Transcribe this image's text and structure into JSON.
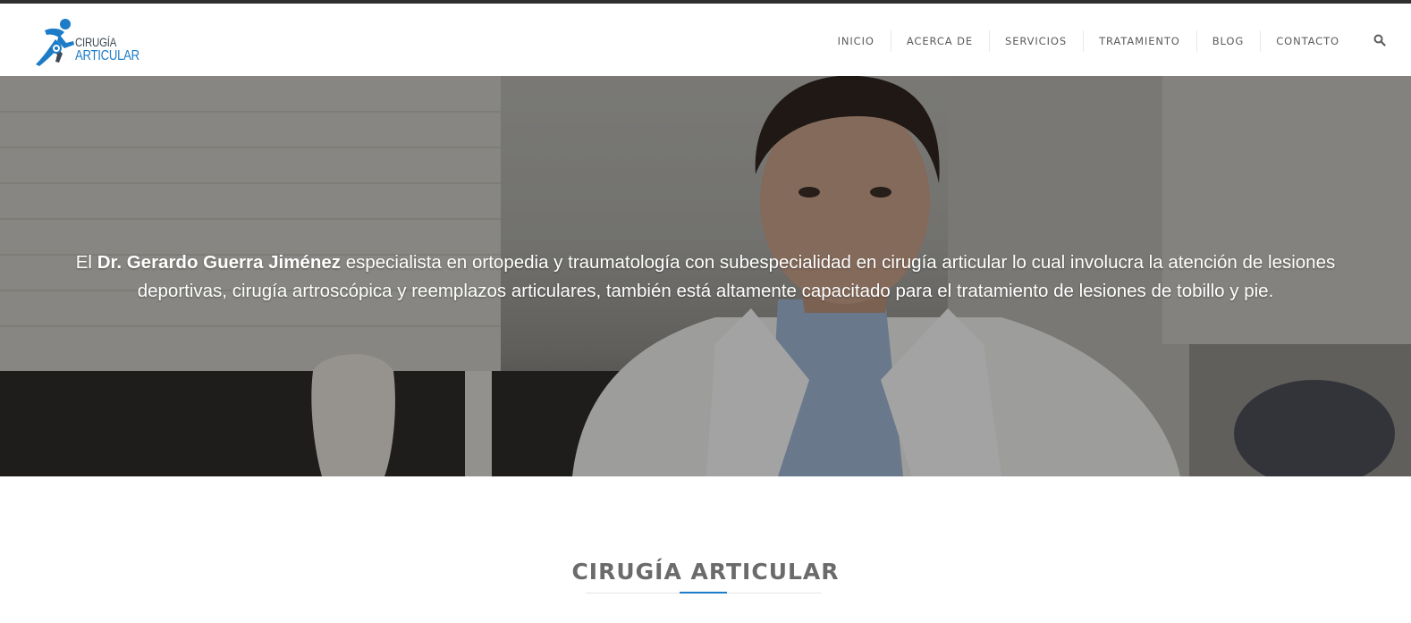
{
  "brand": {
    "line1": "CIRUGÍA",
    "line2": "ARTICULAR",
    "accent_color": "#1d7cc8",
    "icon": "runner-logo-icon"
  },
  "nav": {
    "items": [
      "INICIO",
      "ACERCA DE",
      "SERVICIOS",
      "TRATAMIENTO",
      "BLOG",
      "CONTACTO"
    ],
    "search_icon": "search-icon"
  },
  "hero": {
    "text_prefix": "El ",
    "text_bold": "Dr. Gerardo Guerra Jiménez",
    "text_rest": " especialista en ortopedia y traumatología con subespecialidad en cirugía articular lo cual involucra la atención de lesiones deportivas, cirugía artroscópica y reemplazos articulares, también está altamente capacitado para el tratamiento de lesiones de tobillo y pie."
  },
  "section": {
    "title": "CIRUGÍA ARTICULAR"
  }
}
